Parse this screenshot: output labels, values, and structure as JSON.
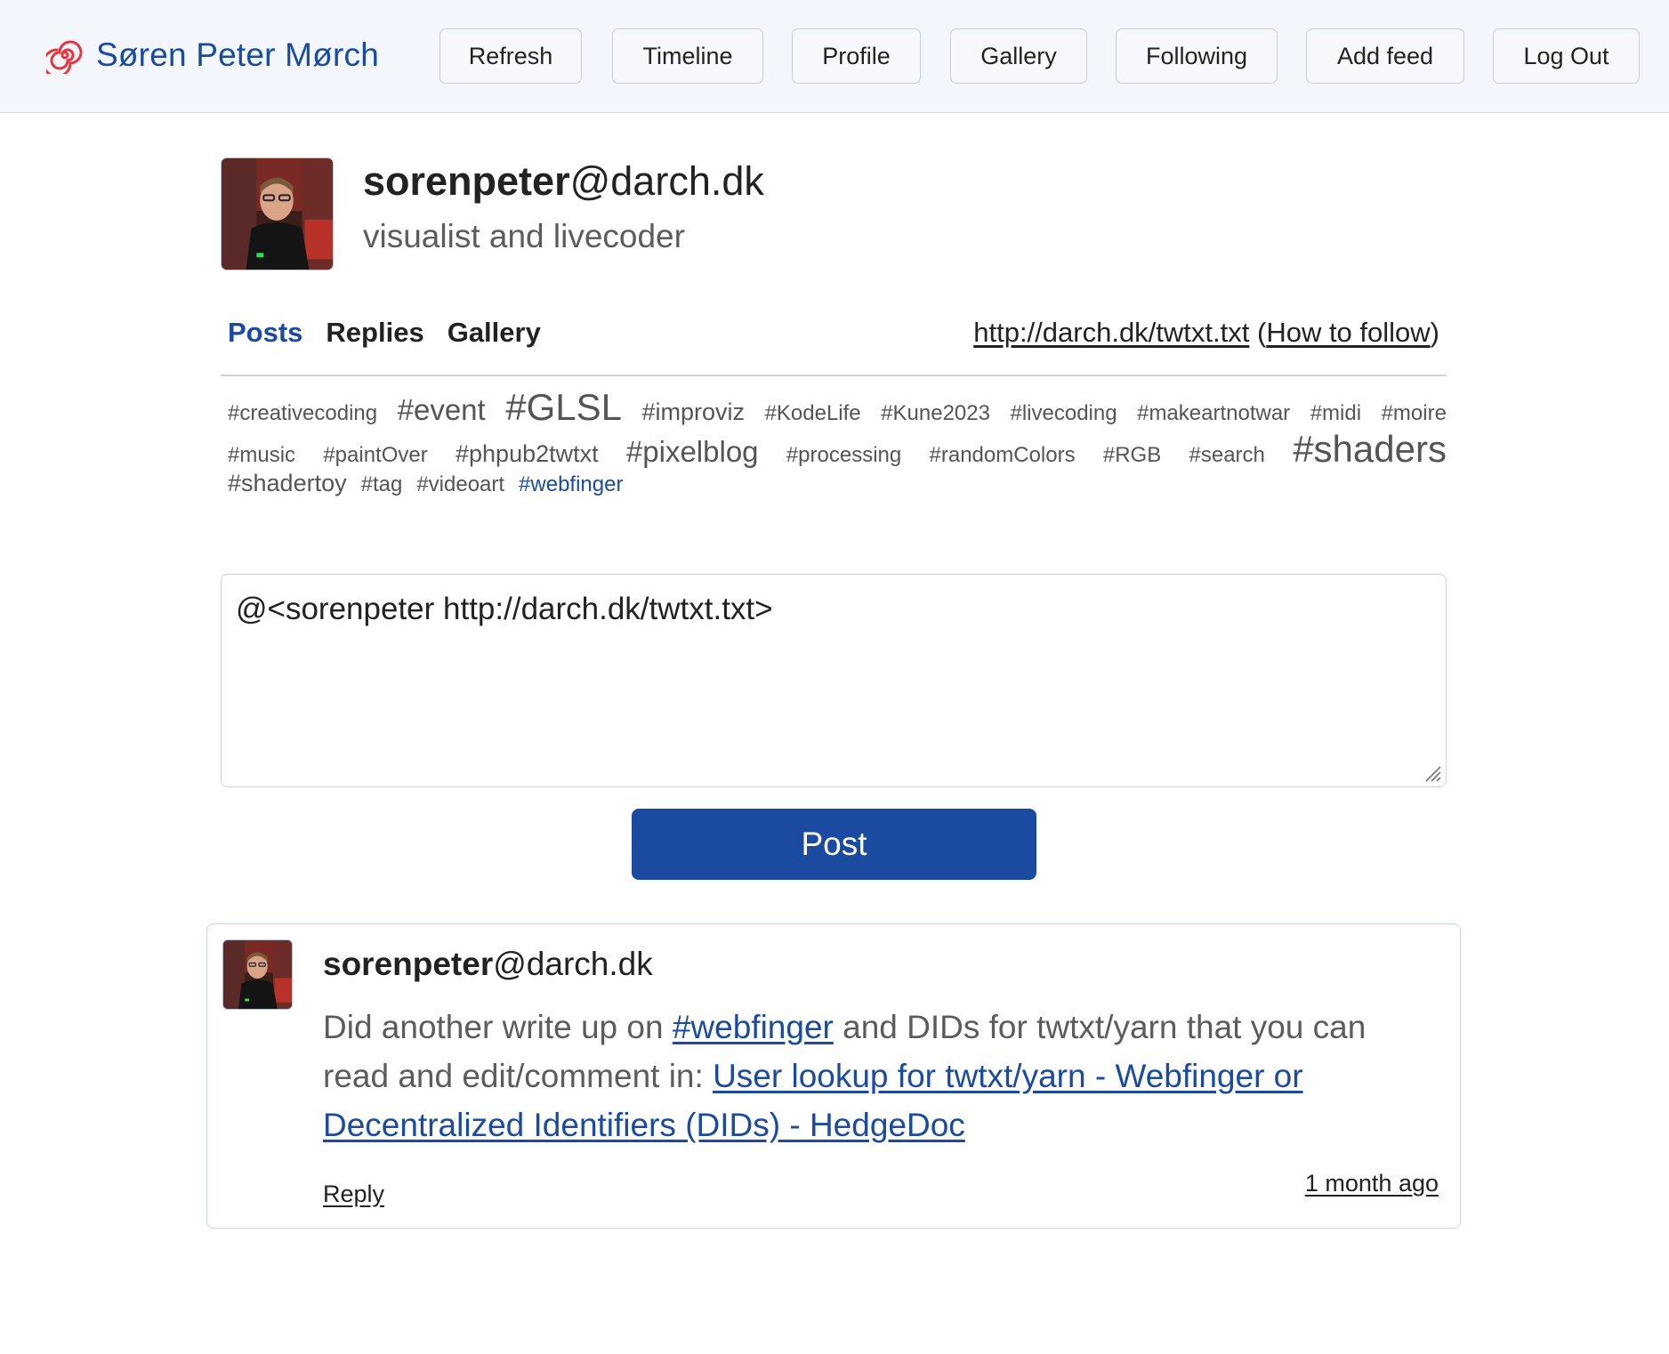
{
  "header": {
    "brand_name": "Søren Peter Mørch",
    "nav": {
      "refresh": "Refresh",
      "timeline": "Timeline",
      "profile": "Profile",
      "gallery": "Gallery",
      "following": "Following",
      "add_feed": "Add feed",
      "log_out": "Log Out"
    }
  },
  "profile": {
    "nick": "sorenpeter",
    "domain": "@darch.dk",
    "bio": "visualist and livecoder",
    "tabs": {
      "posts": "Posts",
      "replies": "Replies",
      "gallery": "Gallery"
    },
    "feed_url": "http://darch.dk/twtxt.txt",
    "how_to_follow": "How to follow"
  },
  "tags": {
    "creativecoding": "#creativecoding",
    "event": "#event",
    "glsl": "#GLSL",
    "improviz": "#improviz",
    "kodelife": "#KodeLife",
    "kune2023": "#Kune2023",
    "livecoding": "#livecoding",
    "makeartnotwar": "#makeartnotwar",
    "midi": "#midi",
    "moire": "#moire",
    "music": "#music",
    "paintover": "#paintOver",
    "phpub2twtxt": "#phpub2twtxt",
    "pixelblog": "#pixelblog",
    "processing": "#processing",
    "randomcolors": "#randomColors",
    "rgb": "#RGB",
    "search": "#search",
    "shaders": "#shaders",
    "shadertoy": "#shadertoy",
    "tag": "#tag",
    "videoart": "#videoart",
    "webfinger": "#webfinger"
  },
  "compose": {
    "value": "@<sorenpeter http://darch.dk/twtxt.txt>",
    "submit_label": "Post"
  },
  "post": {
    "nick": "sorenpeter",
    "domain": "@darch.dk",
    "text_1": "Did another write up on ",
    "hashtag": "#webfinger",
    "text_2": " and DIDs for twtxt/yarn that you can read and edit/comment in: ",
    "link_text": "User lookup for twtxt/yarn - Webfinger or Decentralized Identifiers (DIDs) - HedgeDoc",
    "reply_label": "Reply",
    "timestamp": "1 month ago"
  },
  "colors": {
    "accent": "#1a4ba0",
    "logo": "#e8353b",
    "header_bg": "#f3f6fc",
    "muted_text": "#5c5c5c"
  },
  "icons": {
    "logo": "spiral-icon",
    "resize": "resize-grip-icon"
  }
}
